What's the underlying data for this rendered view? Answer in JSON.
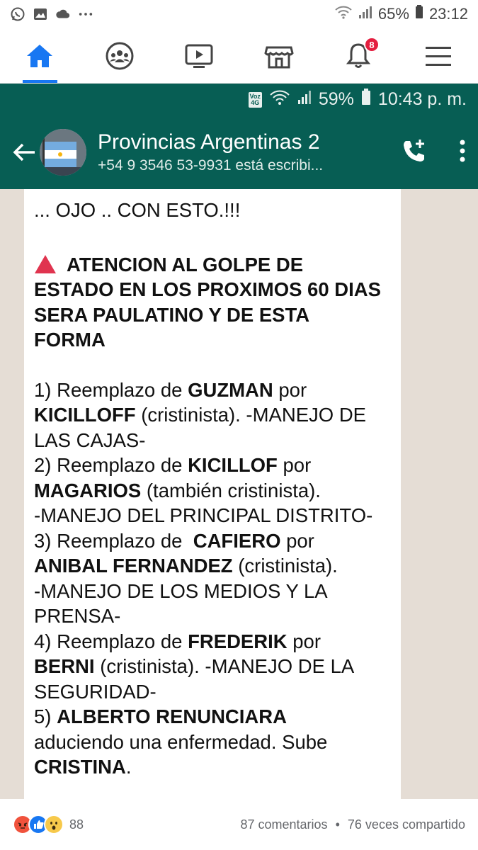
{
  "fb_status": {
    "battery": "65%",
    "time": "23:12",
    "icons": [
      "whatsapp-icon",
      "gallery-icon",
      "cloud-icon",
      "more-dots-icon",
      "wifi-icon",
      "signal-icon",
      "battery-icon"
    ]
  },
  "fb_nav": {
    "items": [
      "home-icon",
      "groups-icon",
      "watch-icon",
      "marketplace-icon",
      "notifications-icon",
      "menu-icon"
    ],
    "notifications_badge": "8",
    "accent_color": "#1877f2"
  },
  "whatsapp": {
    "status": {
      "network_badge_top": "Voz",
      "network_badge_bottom": "4G",
      "battery": "59%",
      "time": "10:43 p. m."
    },
    "header": {
      "title": "Provincias Argentinas 2",
      "subtitle": "+54 9 3546 53-9931 está escribi...",
      "color": "#075e54"
    },
    "message": {
      "l1": "... OJO .. CON ESTO.!!!",
      "warn_line1": "ATENCION AL GOLPE DE",
      "warn_line2": "ESTADO EN LOS PROXIMOS 60 DIAS",
      "warn_line3": "SERA PAULATINO Y DE ESTA",
      "warn_line4": "FORMA",
      "p1_a": "1) Reemplazo de ",
      "p1_b": "GUZMAN",
      "p1_c": " por",
      "p1_d": "KICILLOFF",
      "p1_e": " (cristinista). -MANEJO DE",
      "p1_f": "LAS CAJAS-",
      "p2_a": "2) Reemplazo de ",
      "p2_b": "KICILLOF",
      "p2_c": " por",
      "p2_d": "MAGARIOS",
      "p2_e": " (también cristinista).",
      "p2_f": "-MANEJO DEL PRINCIPAL DISTRITO-",
      "p3_a": "3) Reemplazo de  ",
      "p3_b": "CAFIERO",
      "p3_c": " por",
      "p3_d": "ANIBAL FERNANDEZ",
      "p3_e": " (cristinista).",
      "p3_f": "-MANEJO DE LOS MEDIOS Y LA",
      "p3_g": "PRENSA-",
      "p4_a": "4) Reemplazo de ",
      "p4_b": "FREDERIK",
      "p4_c": " por",
      "p4_d": "BERNI",
      "p4_e": " (cristinista). -MANEJO DE LA",
      "p4_f": "SEGURIDAD-",
      "p5_a": "5) ",
      "p5_b": "ALBERTO RENUNCIARA",
      "p5_c": "aduciendo una enfermedad. Sube",
      "p5_d": "CRISTINA",
      "p5_e": "."
    }
  },
  "fb_footer": {
    "reaction_count": "88",
    "comments": "87 comentarios",
    "separator": "•",
    "shares": "76 veces compartido",
    "reactions": [
      "angry-icon",
      "like-icon",
      "wow-icon"
    ]
  }
}
